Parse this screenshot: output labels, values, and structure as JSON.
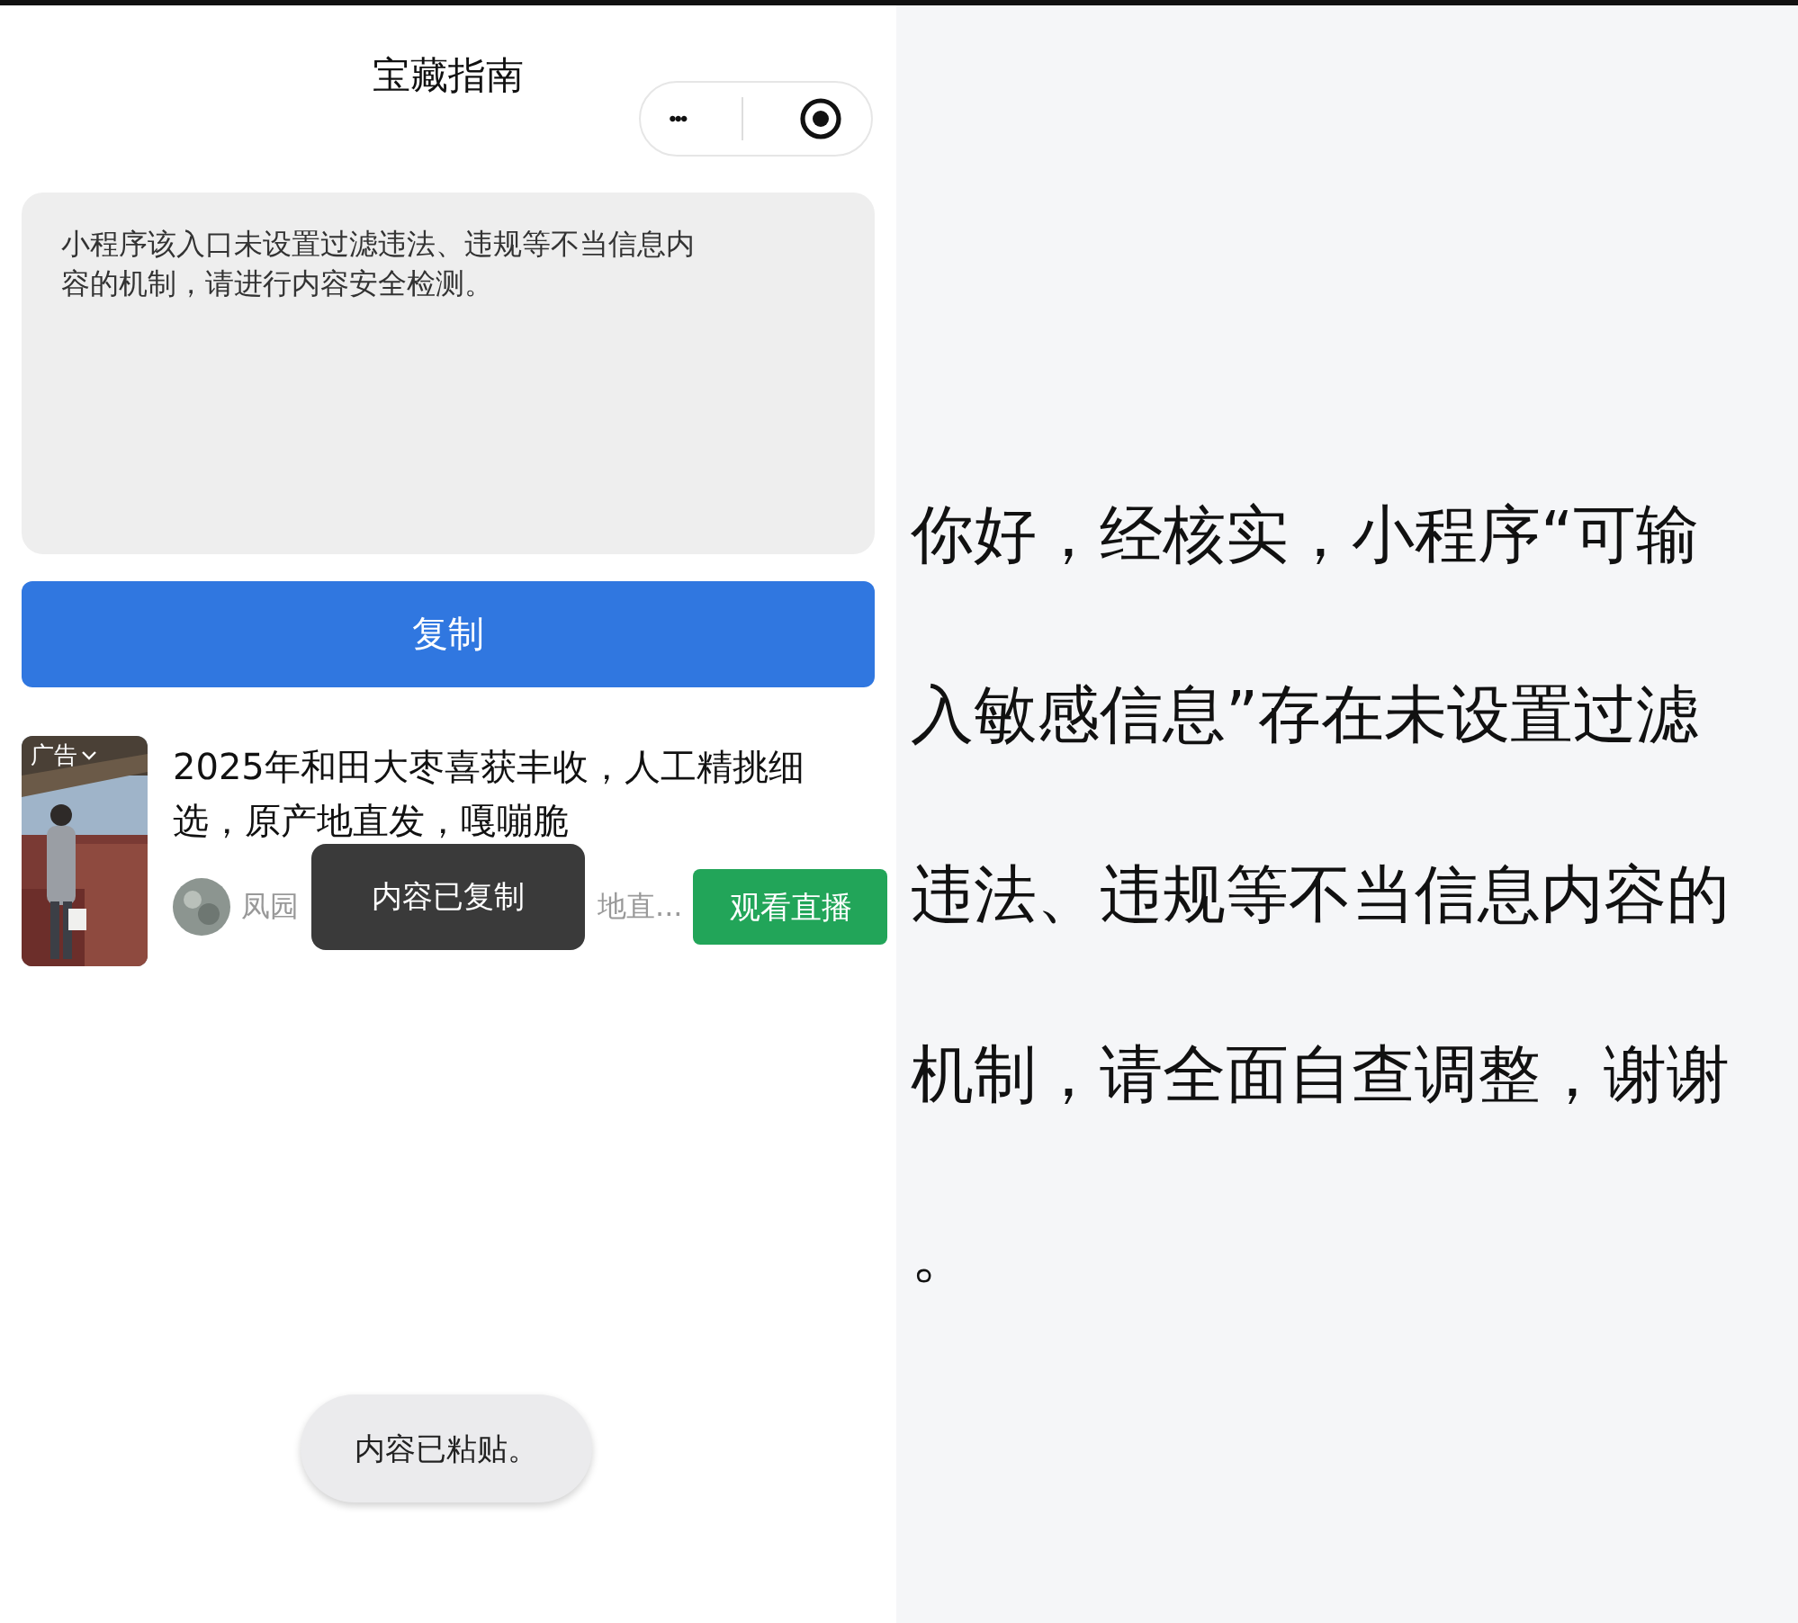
{
  "header": {
    "title": "宝藏指南",
    "capsule": {
      "more": "•••"
    }
  },
  "notice_box": {
    "text": "小程序该入口未设置过滤违法、违规等不当信息内容的机制，请进行内容安全检测。"
  },
  "copy_button": "复制",
  "ad": {
    "label": "广告",
    "title": "2025年和田大枣喜获丰收，人工精挑细选，原产地直发，嘎嘣脆",
    "source_start": "凤园",
    "source_end": "地直...",
    "action": "观看直播"
  },
  "toast": "内容已复制",
  "paste_toast": "内容已粘贴。",
  "message": {
    "lines": [
      "你好，经核实，小程序“可输",
      "入敏感信息”存在未设置过滤",
      "违法、违规等不当信息内容的",
      "机制，请全面自查调整，谢谢",
      "。"
    ]
  }
}
